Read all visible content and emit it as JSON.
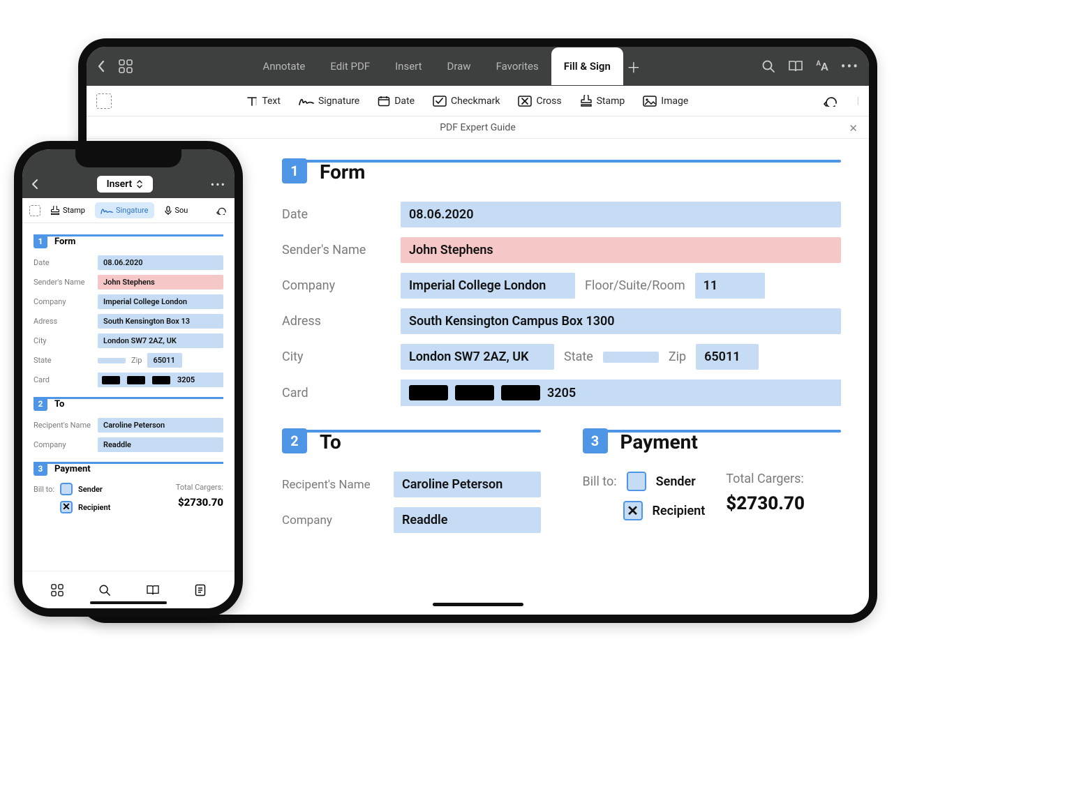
{
  "ipad": {
    "topbar": {
      "tabs": [
        "Annotate",
        "Edit PDF",
        "Insert",
        "Draw",
        "Favorites",
        "Fill & Sign"
      ],
      "active_tab": "Fill & Sign"
    },
    "toolrow": {
      "items": [
        "Text",
        "Signature",
        "Date",
        "Checkmark",
        "Cross",
        "Stamp",
        "Image"
      ]
    },
    "doc_title": "PDF Expert Guide",
    "form": {
      "section_title": "Form",
      "date_label": "Date",
      "date": "08.06.2020",
      "sender_label": "Sender's Name",
      "sender": "John Stephens",
      "company_label": "Company",
      "company": "Imperial College London",
      "floor_label": "Floor/Suite/Room",
      "floor": "11",
      "address_label": "Adress",
      "address": "South Kensington Campus Box 1300",
      "city_label": "City",
      "city": "London SW7 2AZ, UK",
      "state_label": "State",
      "zip_label": "Zip",
      "zip": "65011",
      "card_label": "Card",
      "card_last": "3205"
    },
    "to": {
      "section_title": "To",
      "recipient_label": "Recipent's Name",
      "recipient": "Caroline Peterson",
      "company_label": "Company",
      "company": "Readdle"
    },
    "payment": {
      "section_title": "Payment",
      "billto_label": "Bill to:",
      "sender_label": "Sender",
      "recipient_label": "Recipient",
      "total_label": "Total Cargers:",
      "total": "$2730.70"
    }
  },
  "iphone": {
    "title": "Insert",
    "toolrow": {
      "stamp": "Stamp",
      "signature": "Singature",
      "sound_partial": "Sou"
    },
    "form": {
      "section_title": "Form",
      "date_label": "Date",
      "date": "08.06.2020",
      "sender_label": "Sender's Name",
      "sender": "John Stephens",
      "company_label": "Company",
      "company": "Imperial College London",
      "address_label": "Adress",
      "address": "South Kensington Box 13",
      "city_label": "City",
      "city": "London SW7 2AZ, UK",
      "state_label": "State",
      "zip_label": "Zip",
      "zip": "65011",
      "card_label": "Card",
      "card_last": "3205"
    },
    "to": {
      "section_title": "To",
      "recipient_label": "Recipent's Name",
      "recipient": "Caroline Peterson",
      "company_label": "Company",
      "company": "Readdle"
    },
    "payment": {
      "section_title": "Payment",
      "billto_label": "Bill to:",
      "sender_label": "Sender",
      "recipient_label": "Recipient",
      "total_label": "Total Cargers:",
      "total": "$2730.70"
    }
  }
}
